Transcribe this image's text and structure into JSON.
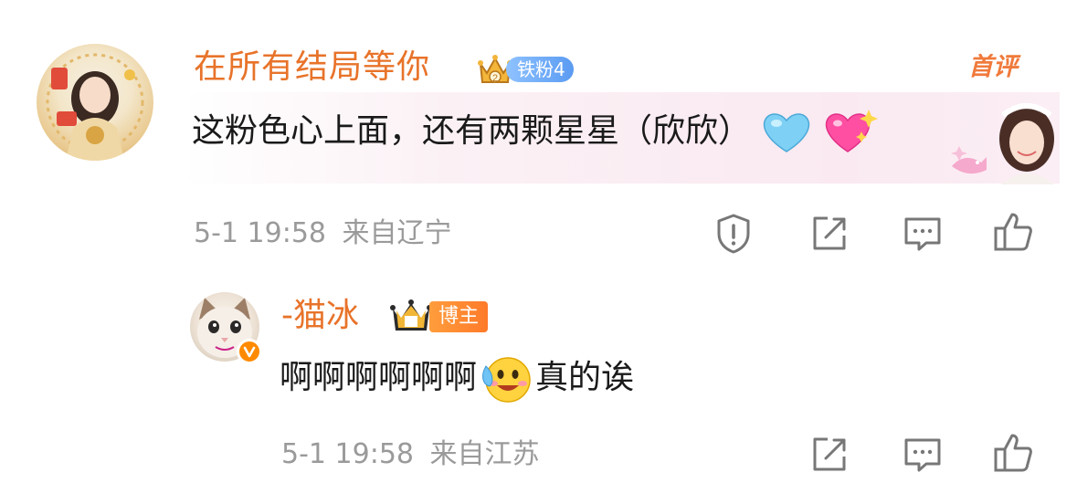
{
  "comment": {
    "username": "在所有结局等你",
    "fan_badge": "铁粉4",
    "fan_badge_crown_number": "2",
    "first_comment_tag": "首评",
    "text": "这粉色心上面，还有两颗星星（欣欣）",
    "emojis": [
      "blue-heart-icon",
      "sparkling-heart-icon"
    ],
    "time": "5-1 19:58",
    "location": "来自辽宁",
    "actions": [
      "report-icon",
      "share-icon",
      "reply-icon",
      "like-icon"
    ]
  },
  "reply": {
    "username": "-猫冰",
    "role_tag": "博主",
    "text_before": "啊啊啊啊啊啊",
    "text_after": "真的诶",
    "emojis": [
      "sweat-smile-face-icon"
    ],
    "time": "5-1 19:58",
    "location": "来自江苏",
    "actions": [
      "share-icon",
      "reply-icon",
      "like-icon"
    ]
  },
  "colors": {
    "username": "#e8732a",
    "meta": "#9a9a9a",
    "fan_badge": "#6aa6f5",
    "blogger_tag": "#ff8a30",
    "icon": "#777777"
  }
}
